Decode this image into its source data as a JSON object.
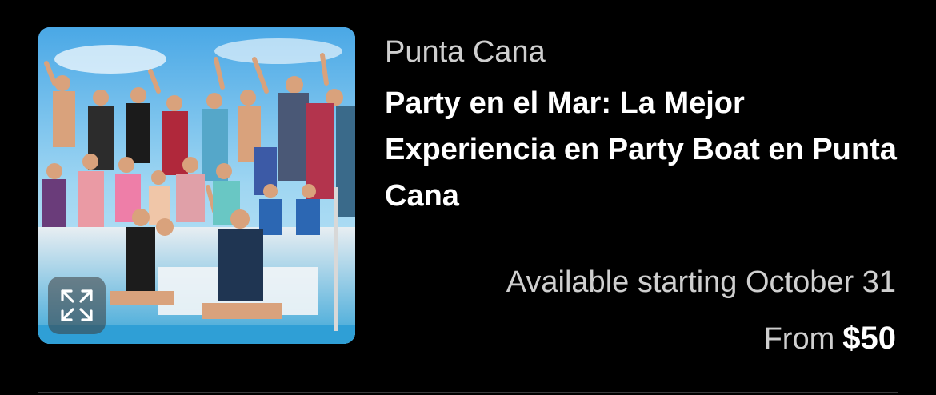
{
  "listing": {
    "location": "Punta Cana",
    "title": "Party en el Mar: La Mejor Experiencia en Party Boat en Punta Cana",
    "availability": "Available starting October 31",
    "price_prefix": "From",
    "price": "$50"
  },
  "thumbnail": {
    "alt": "Group of people celebrating on a party boat",
    "expand_icon": "expand-arrows-icon"
  },
  "colors": {
    "background": "#000000",
    "primary_text": "#ffffff",
    "secondary_text": "#cfcfcf",
    "divider": "#3a3a3c"
  }
}
